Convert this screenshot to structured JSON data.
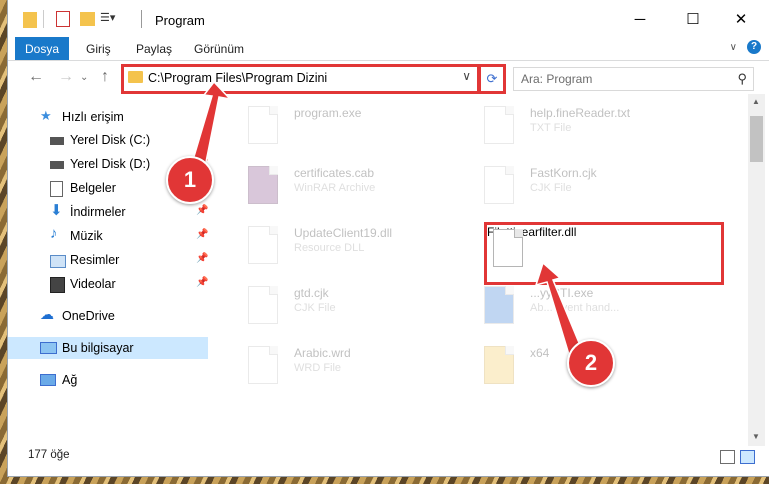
{
  "window": {
    "title": "Program"
  },
  "ribbon": {
    "tabs": [
      "Dosya",
      "Giriş",
      "Paylaş",
      "Görünüm"
    ]
  },
  "address": {
    "path": "C:\\Program Files\\Program Dizini"
  },
  "search": {
    "placeholder": "Ara: Program"
  },
  "sidebar": {
    "items": [
      {
        "label": "Hızlı erişim",
        "icon": "star-icon"
      },
      {
        "label": "Yerel Disk (C:)",
        "icon": "drive-icon"
      },
      {
        "label": "Yerel Disk (D:)",
        "icon": "drive-icon"
      },
      {
        "label": "Belgeler",
        "icon": "document-icon"
      },
      {
        "label": "İndirmeler",
        "icon": "download-arrow-icon"
      },
      {
        "label": "Müzik",
        "icon": "music-note-icon"
      },
      {
        "label": "Resimler",
        "icon": "pictures-icon"
      },
      {
        "label": "Videolar",
        "icon": "film-icon"
      },
      {
        "label": "OneDrive",
        "icon": "cloud-icon"
      },
      {
        "label": "Bu bilgisayar",
        "icon": "computer-icon",
        "selected": true
      },
      {
        "label": "Ağ",
        "icon": "network-icon"
      }
    ]
  },
  "files": [
    {
      "name": "program.exe",
      "type": ""
    },
    {
      "name": "certificates.cab",
      "type": "WinRAR Archive"
    },
    {
      "name": "UpdateClient19.dll",
      "type": "Resource DLL"
    },
    {
      "name": "gtd.cjk",
      "type": "CJK File"
    },
    {
      "name": "Arabic.wrd",
      "type": "WRD File"
    },
    {
      "name": "help.fineReader.txt",
      "type": "TXT File"
    },
    {
      "name": "FastKorn.cjk",
      "type": "CJK File"
    },
    {
      "name": "Filatticearfilter.dll",
      "type": "",
      "highlighted": true
    },
    {
      "name": "...yySTI.exe",
      "type": "Ab... event hand..."
    },
    {
      "name": "x64",
      "type": ""
    }
  ],
  "status": {
    "count": "177 öğe"
  },
  "callouts": [
    "1",
    "2"
  ],
  "colors": {
    "accent": "#1979ca",
    "highlight": "#e13636",
    "selection": "#cce8ff"
  }
}
